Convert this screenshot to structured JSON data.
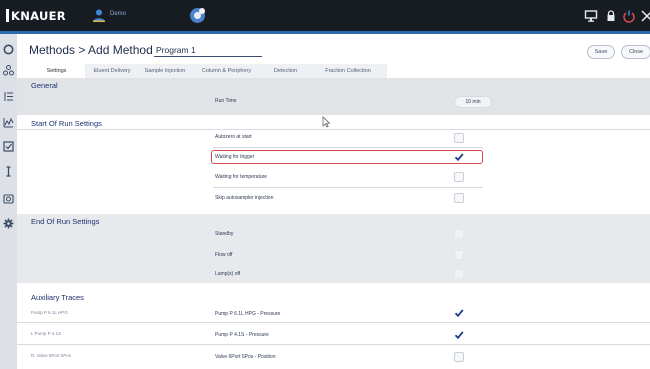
{
  "app": {
    "brand": "KNAUER",
    "user": "Demo"
  },
  "header": {
    "title": "Methods  >  Add Method",
    "program_name": "Program 1",
    "save_label": "Save",
    "close_label": "Close"
  },
  "tabs": [
    {
      "label": "Settings",
      "active": true
    },
    {
      "label": "Eluent Delivery",
      "active": false
    },
    {
      "label": "Sample Injection",
      "active": false
    },
    {
      "label": "Column & Periphery",
      "active": false
    },
    {
      "label": "Detection",
      "active": false
    },
    {
      "label": "Fraction Collection",
      "active": false
    }
  ],
  "general": {
    "title": "General",
    "run_time_label": "Run Time",
    "run_time_value": "10 min"
  },
  "start_of_run": {
    "title": "Start Of Run Settings",
    "items": [
      {
        "label": "Autozero at start",
        "checked": false
      },
      {
        "label": "Waiting for trigger",
        "checked": true,
        "highlighted": true
      },
      {
        "label": "Waiting for temperature",
        "checked": false
      },
      {
        "label": "Skip autosampler injection",
        "checked": false
      }
    ]
  },
  "end_of_run": {
    "title": "End Of Run Settings",
    "items": [
      {
        "label": "Standby",
        "checked": false
      },
      {
        "label": "Flow off",
        "checked": false
      },
      {
        "label": "Lamp(s) off",
        "checked": false
      }
    ]
  },
  "auxiliary": {
    "title": "Auxiliary Traces",
    "items": [
      {
        "source": "Pump P 6.1L HPG",
        "label": "Pump P 6.1L HPG - Pressure",
        "checked": true
      },
      {
        "source": "L Pump P 4.1S",
        "label": "Pump P 4.1S - Pressure",
        "checked": true
      },
      {
        "source": "R. Valve 6Port 6Pos",
        "label": "Valve 6Port 6Pos - Position",
        "checked": false
      }
    ]
  },
  "colors": {
    "topbar": "#171b22",
    "accent": "#2b6cb0",
    "highlight": "#d84a4a",
    "check": "#1f3f86"
  },
  "icons": {
    "topbar": [
      "knauer-logo-icon",
      "user-icon",
      "network-icon",
      "display-icon",
      "lock-icon",
      "power-icon",
      "close-icon"
    ],
    "rail": [
      "circle-icon",
      "people-icon",
      "list-icon",
      "chart-icon",
      "check-square-icon",
      "text-cursor-icon",
      "camera-icon",
      "gear-icon"
    ]
  }
}
